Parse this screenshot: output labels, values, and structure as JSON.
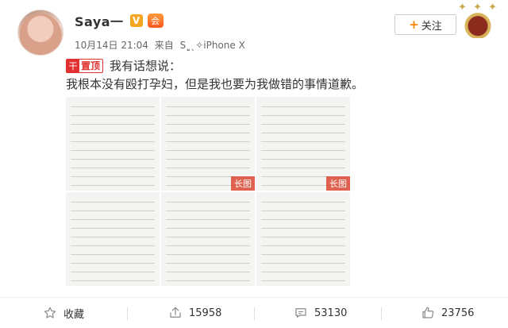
{
  "post": {
    "user": {
      "name": "Saya一",
      "verified_badge": "V",
      "member_badge": "会"
    },
    "meta": {
      "date": "10月14日 21:04",
      "from": "来自",
      "device": "Sˎ͈ˎ✧iPhone X"
    },
    "follow_label": "+关注",
    "follow_text": "关注",
    "deco_text": "✦ ✦ ✦",
    "pin": {
      "mark": "干",
      "label": "置顶"
    },
    "pin_text": "我有话想说：",
    "body": "我根本没有殴打孕妇，但是我也要为我做错的事情道歉。",
    "image_tags": [
      "长图",
      "长图"
    ]
  },
  "actions": [
    {
      "label": "收藏",
      "icon": "star-icon"
    },
    {
      "label": "15958",
      "icon": "share-icon"
    },
    {
      "label": "53130",
      "icon": "comment-icon"
    },
    {
      "label": "23756",
      "icon": "like-icon"
    }
  ],
  "colors": {
    "accent": "#ff8200",
    "pin_red": "#e03030",
    "badge_orange": "#f5a623"
  }
}
